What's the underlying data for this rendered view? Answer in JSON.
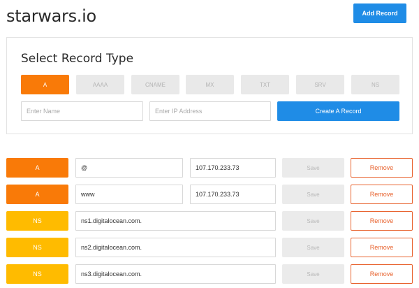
{
  "header": {
    "domain_title": "starwars.io",
    "add_record_label": "Add Record"
  },
  "select_panel": {
    "title": "Select Record Type",
    "types": [
      {
        "label": "A",
        "active": true
      },
      {
        "label": "AAAA",
        "active": false
      },
      {
        "label": "CNAME",
        "active": false
      },
      {
        "label": "MX",
        "active": false
      },
      {
        "label": "TXT",
        "active": false
      },
      {
        "label": "SRV",
        "active": false
      },
      {
        "label": "NS",
        "active": false
      }
    ],
    "name_placeholder": "Enter Name",
    "ip_placeholder": "Enter IP Address",
    "name_value": "",
    "ip_value": "",
    "create_label": "Create A Record"
  },
  "records": [
    {
      "type": "A",
      "name": "@",
      "value": "107.170.233.73",
      "save_label": "Save",
      "remove_label": "Remove"
    },
    {
      "type": "A",
      "name": "www",
      "value": "107.170.233.73",
      "save_label": "Save",
      "remove_label": "Remove"
    },
    {
      "type": "NS",
      "name": "ns1.digitalocean.com.",
      "save_label": "Save",
      "remove_label": "Remove"
    },
    {
      "type": "NS",
      "name": "ns2.digitalocean.com.",
      "save_label": "Save",
      "remove_label": "Remove"
    },
    {
      "type": "NS",
      "name": "ns3.digitalocean.com.",
      "save_label": "Save",
      "remove_label": "Remove"
    }
  ],
  "colors": {
    "primary_blue": "#1f8ce6",
    "record_a_orange": "#f97a08",
    "record_ns_yellow": "#ffbb00",
    "remove_red": "#e8632f",
    "inactive_gray": "#e9e9e9"
  }
}
